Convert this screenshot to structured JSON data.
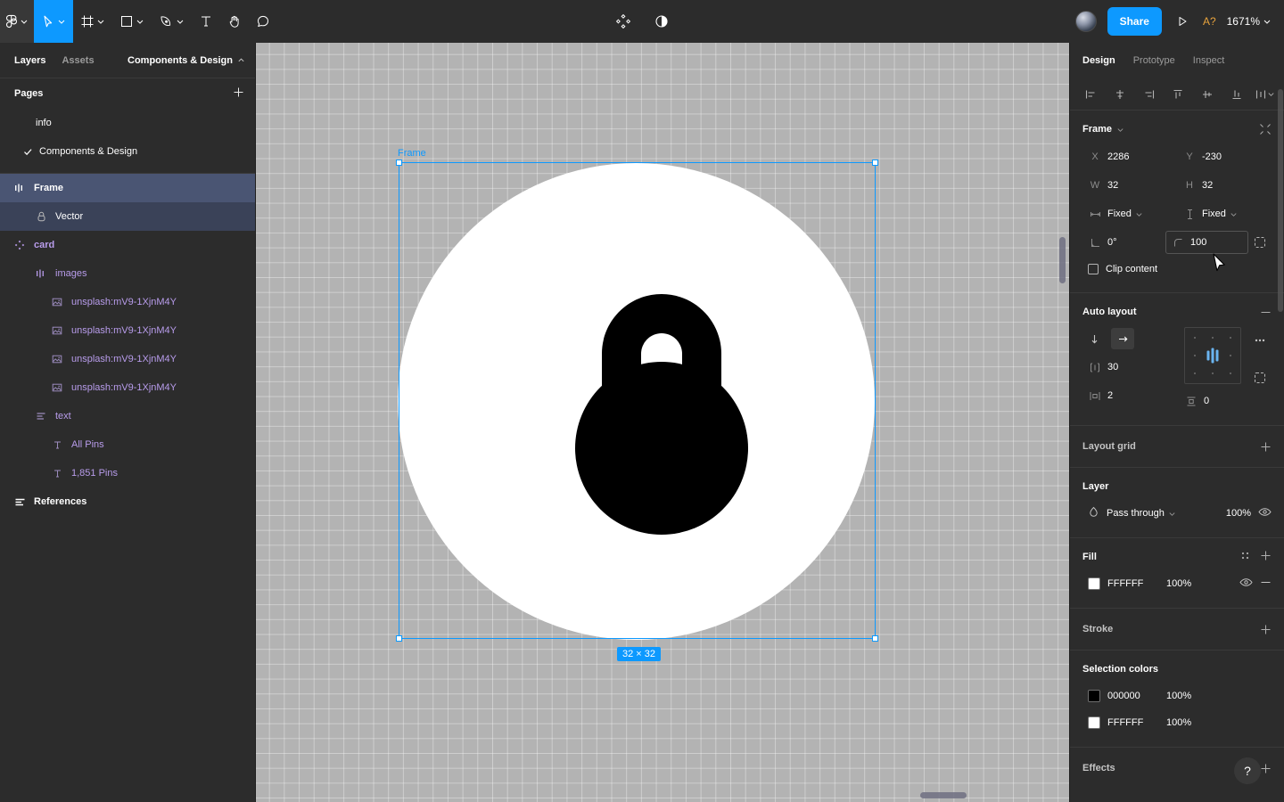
{
  "toolbar": {
    "menu_icon": "figma-logo-icon",
    "tools": [
      {
        "name": "move-tool",
        "icon": "cursor-icon",
        "active": true
      },
      {
        "name": "frame-tool",
        "icon": "frame-icon",
        "active": false
      },
      {
        "name": "shape-tool",
        "icon": "square-icon",
        "active": false
      },
      {
        "name": "pen-tool",
        "icon": "pen-icon",
        "active": false
      },
      {
        "name": "text-tool",
        "icon": "text-icon",
        "active": false
      },
      {
        "name": "hand-tool",
        "icon": "hand-icon",
        "active": false
      },
      {
        "name": "comment-tool",
        "icon": "comment-icon",
        "active": false
      }
    ],
    "center_icons": [
      "components-icon",
      "contrast-icon"
    ],
    "share_label": "Share",
    "present_icon": "play-icon",
    "assist_label": "A?",
    "zoom_label": "1671%"
  },
  "left_panel": {
    "tabs": [
      {
        "label": "Layers",
        "active": true
      },
      {
        "label": "Assets",
        "active": false
      }
    ],
    "file_name": "Components & Design",
    "pages_label": "Pages",
    "pages": [
      {
        "label": "info",
        "current": false
      },
      {
        "label": "Components & Design",
        "current": true
      }
    ],
    "layers": [
      {
        "label": "Frame",
        "icon": "autolayout-icon",
        "level": 0,
        "state": "selected-parent",
        "color": "white",
        "bold": true
      },
      {
        "label": "Vector",
        "icon": "lock-icon",
        "level": 1,
        "state": "selected-child",
        "color": "white",
        "bold": false
      },
      {
        "label": "card",
        "icon": "component-icon",
        "level": 0,
        "state": "none",
        "color": "purple",
        "bold": true
      },
      {
        "label": "images",
        "icon": "autolayout-icon",
        "level": 1,
        "state": "none",
        "color": "purple",
        "bold": false
      },
      {
        "label": "unsplash:mV9-1XjnM4Y",
        "icon": "image-icon",
        "level": 2,
        "state": "none",
        "color": "purple",
        "bold": false
      },
      {
        "label": "unsplash:mV9-1XjnM4Y",
        "icon": "image-icon",
        "level": 2,
        "state": "none",
        "color": "purple",
        "bold": false
      },
      {
        "label": "unsplash:mV9-1XjnM4Y",
        "icon": "image-icon",
        "level": 2,
        "state": "none",
        "color": "purple",
        "bold": false
      },
      {
        "label": "unsplash:mV9-1XjnM4Y",
        "icon": "image-icon",
        "level": 2,
        "state": "none",
        "color": "purple",
        "bold": false
      },
      {
        "label": "text",
        "icon": "list-icon",
        "level": 1,
        "state": "none",
        "color": "purple",
        "bold": false
      },
      {
        "label": "All Pins",
        "icon": "text-icon",
        "level": 2,
        "state": "none",
        "color": "purple",
        "bold": false
      },
      {
        "label": "1,851 Pins",
        "icon": "text-icon",
        "level": 2,
        "state": "none",
        "color": "purple",
        "bold": false
      },
      {
        "label": "References",
        "icon": "list-icon",
        "level": 0,
        "state": "none",
        "color": "white",
        "bold": true
      }
    ]
  },
  "canvas": {
    "frame_label": "Frame",
    "size_badge": "32 × 32",
    "artwork": "padlock-icon",
    "background_color": "#b3b3b3",
    "circle_color": "#ffffff",
    "lock_color": "#000000",
    "selection_color": "#0d99ff"
  },
  "right_panel": {
    "tabs": [
      {
        "label": "Design",
        "active": true
      },
      {
        "label": "Prototype",
        "active": false
      },
      {
        "label": "Inspect",
        "active": false
      }
    ],
    "align_icons": [
      "align-left-icon",
      "align-horizontal-center-icon",
      "align-right-icon",
      "align-top-icon",
      "align-vertical-center-icon",
      "align-bottom-icon",
      "distribute-icon"
    ],
    "frame": {
      "title": "Frame",
      "collapse_icon": "collapse-icon",
      "x_label": "X",
      "x_value": "2286",
      "y_label": "Y",
      "y_value": "-230",
      "w_label": "W",
      "w_value": "32",
      "h_label": "H",
      "h_value": "32",
      "h_resize": "Fixed",
      "v_resize": "Fixed",
      "rotation": "0°",
      "corner_radius": "100",
      "independent_corners_icon": "independent-corners-icon",
      "clip_content_label": "Clip content",
      "clip_content_checked": false
    },
    "auto_layout": {
      "title": "Auto layout",
      "remove_icon": "minus-icon",
      "direction_vertical_icon": "arrow-down-icon",
      "direction_horizontal_icon": "arrow-right-icon",
      "direction_selected": "horizontal",
      "gap_label": "gap-icon",
      "gap_value": "30",
      "padding_h_label": "horizontal-padding-icon",
      "padding_h_value": "2",
      "padding_v_label": "vertical-padding-icon",
      "padding_v_value": "0",
      "more_icon": "more-options-icon",
      "clip_icon": "clip-icon",
      "alignment": "center"
    },
    "layout_grid": {
      "title": "Layout grid",
      "add_icon": "plus-icon"
    },
    "layer": {
      "title": "Layer",
      "blend_mode": "Pass through",
      "opacity": "100%",
      "visibility_icon": "eye-icon"
    },
    "fill": {
      "title": "Fill",
      "style_icon": "styles-icon",
      "add_icon": "plus-icon",
      "items": [
        {
          "hex": "FFFFFF",
          "opacity": "100%",
          "swatch": "#ffffff"
        }
      ]
    },
    "stroke": {
      "title": "Stroke",
      "add_icon": "plus-icon"
    },
    "selection_colors": {
      "title": "Selection colors",
      "items": [
        {
          "hex": "000000",
          "opacity": "100%",
          "swatch": "#000000"
        },
        {
          "hex": "FFFFFF",
          "opacity": "100%",
          "swatch": "#ffffff"
        }
      ]
    },
    "effects": {
      "title": "Effects",
      "add_icon": "plus-icon"
    },
    "help_label": "?"
  }
}
